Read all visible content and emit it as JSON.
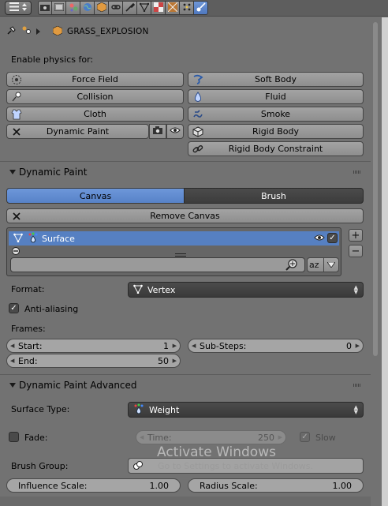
{
  "header": {
    "tabs": [
      "render-icon",
      "render-layers-icon",
      "scene-icon",
      "world-icon",
      "object-icon",
      "constraints-icon",
      "modifiers-icon",
      "data-icon",
      "material-icon",
      "texture-icon",
      "particles-icon",
      "physics-icon"
    ],
    "active_tab": "physics-icon"
  },
  "breadcrumb": {
    "object_name": "GRASS_EXPLOSION"
  },
  "physics": {
    "enable_label": "Enable physics for:",
    "buttons_left": [
      {
        "label": "Force Field",
        "icon": "force-field-icon"
      },
      {
        "label": "Collision",
        "icon": "collision-icon"
      },
      {
        "label": "Cloth",
        "icon": "cloth-icon"
      },
      {
        "label": "Dynamic Paint",
        "icon": "remove-x-icon"
      }
    ],
    "buttons_right": [
      {
        "label": "Soft Body",
        "icon": "soft-body-icon"
      },
      {
        "label": "Fluid",
        "icon": "fluid-icon"
      },
      {
        "label": "Smoke",
        "icon": "smoke-icon"
      },
      {
        "label": "Rigid Body",
        "icon": "rigid-body-icon"
      },
      {
        "label": "Rigid Body Constraint",
        "icon": "rigid-body-constraint-icon"
      }
    ]
  },
  "dynamic_paint": {
    "title": "Dynamic Paint",
    "tab_canvas": "Canvas",
    "tab_brush": "Brush",
    "remove_button": "Remove Canvas",
    "surface_name": "Surface",
    "format_label": "Format:",
    "format_value": "Vertex",
    "antialiasing_label": "Anti-aliasing",
    "antialiasing_checked": true,
    "frames_label": "Frames:",
    "start_label": "Start:",
    "start_value": "1",
    "end_label": "End:",
    "end_value": "50",
    "substeps_label": "Sub-Steps:",
    "substeps_value": "0"
  },
  "dynamic_paint_advanced": {
    "title": "Dynamic Paint Advanced",
    "surface_type_label": "Surface Type:",
    "surface_type_value": "Weight",
    "fade_label": "Fade:",
    "fade_checked": false,
    "time_label": "Time:",
    "time_value": "250",
    "slow_label": "Slow",
    "slow_checked": true,
    "brush_group_label": "Brush Group:",
    "influence_label": "Influence Scale:",
    "influence_value": "1.00",
    "radius_label": "Radius Scale:",
    "radius_value": "1.00"
  },
  "overlay": {
    "watermark_title": "Activate Windows",
    "watermark_sub": "Go to Settings to activate Windows."
  }
}
